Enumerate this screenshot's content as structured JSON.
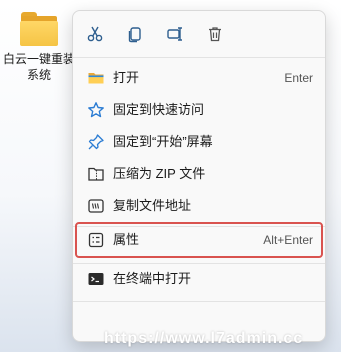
{
  "desktop": {
    "icon": "folder-icon",
    "label_line1": "白云一键重装",
    "label_line2": "系统"
  },
  "context_menu": {
    "toolbar": [
      {
        "name": "cut",
        "icon": "scissors-icon"
      },
      {
        "name": "copy",
        "icon": "copy-icon"
      },
      {
        "name": "rename",
        "icon": "rename-icon"
      },
      {
        "name": "delete",
        "icon": "trash-icon"
      }
    ],
    "items": [
      {
        "label": "打开",
        "shortcut": "Enter",
        "icon": "folder-open-icon"
      },
      {
        "label": "固定到快速访问",
        "shortcut": "",
        "icon": "star-icon"
      },
      {
        "label": "固定到“开始”屏幕",
        "shortcut": "",
        "icon": "pin-icon"
      },
      {
        "label": "压缩为 ZIP 文件",
        "shortcut": "",
        "icon": "zip-icon"
      },
      {
        "label": "复制文件地址",
        "shortcut": "",
        "icon": "copy-path-icon"
      },
      {
        "label": "属性",
        "shortcut": "Alt+Enter",
        "icon": "properties-icon"
      },
      {
        "label": "在终端中打开",
        "shortcut": "",
        "icon": "terminal-icon"
      }
    ],
    "highlight_color": "#d9534f"
  },
  "watermark": "https://www.l7admin.cc",
  "colors": {
    "accent_blue": "#0067c0",
    "folder_yellow": "#f5c445"
  }
}
